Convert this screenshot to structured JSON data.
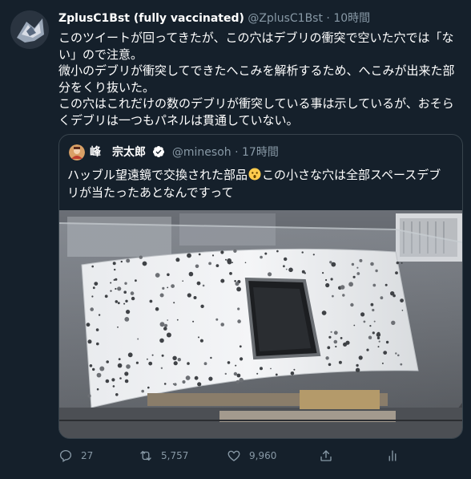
{
  "tweet": {
    "author_name": "ZplusC1Bst (fully vaccinated)",
    "author_handle": "@ZplusC1Bst",
    "separator": "·",
    "time": "10時間",
    "text_lines": [
      "このツイートが回ってきたが、この穴はデブリの衝突で空いた穴では「な",
      "い」ので注意。",
      "微小のデブリが衝突してできたへこみを解析するため、へこみが出来た部",
      "分をくり抜いた。",
      "この穴はこれだけの数のデブリが衝突している事は示しているが、おそら",
      "くデブリは一つもパネルは貫通していない。"
    ]
  },
  "quoted": {
    "author_name": "峰　宗太郎",
    "author_handle": "@minesoh",
    "separator": "·",
    "time": "17時間",
    "text_line1_a": "ハッブル望遠鏡で交換された部品",
    "text_line1_b": "この小さな穴は全部スペースデブ",
    "text_line2": "リが当たったあとなんですって",
    "emoji": "astonished-face"
  },
  "actions": {
    "reply_count": "27",
    "retweet_count": "5,757",
    "like_count": "9,960"
  },
  "colors": {
    "background": "#15202b",
    "border": "#38444d",
    "secondary_text": "#8899a6",
    "verified": "#1d9bf0"
  }
}
